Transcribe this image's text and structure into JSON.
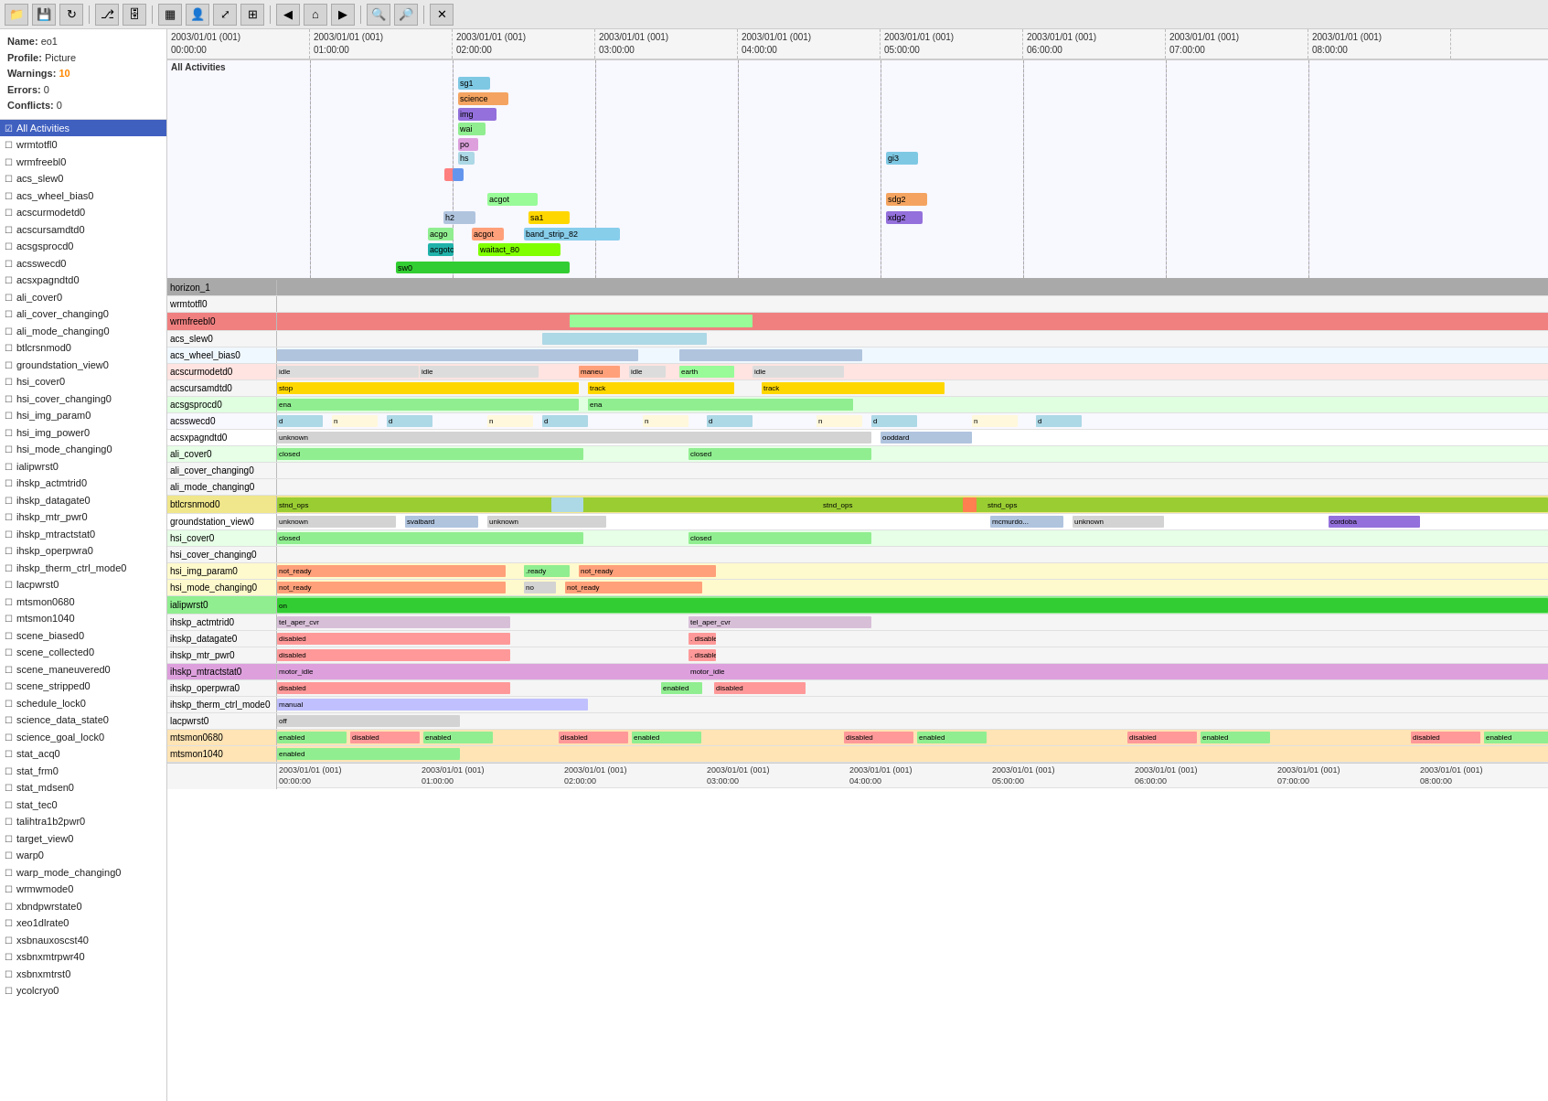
{
  "toolbar": {
    "buttons": [
      {
        "name": "open-folder-btn",
        "icon": "📁",
        "label": "Open Folder"
      },
      {
        "name": "save-btn",
        "icon": "💾",
        "label": "Save"
      },
      {
        "name": "refresh-btn",
        "icon": "🔄",
        "label": "Refresh"
      },
      {
        "name": "branch-btn",
        "icon": "⎇",
        "label": "Branch"
      },
      {
        "name": "db-btn",
        "icon": "🗄",
        "label": "Database"
      },
      {
        "name": "report-btn",
        "icon": "📊",
        "label": "Report"
      },
      {
        "name": "person-btn",
        "icon": "👤",
        "label": "Person"
      },
      {
        "name": "resize-btn",
        "icon": "⤢",
        "label": "Resize"
      },
      {
        "name": "expand-btn",
        "icon": "⊞",
        "label": "Expand"
      },
      {
        "name": "back-btn",
        "icon": "◀",
        "label": "Back"
      },
      {
        "name": "home-btn",
        "icon": "🏠",
        "label": "Home"
      },
      {
        "name": "forward-btn",
        "icon": "▶",
        "label": "Forward"
      },
      {
        "name": "zoom-in-btn",
        "icon": "🔍+",
        "label": "Zoom In"
      },
      {
        "name": "zoom-out-btn",
        "icon": "🔍-",
        "label": "Zoom Out"
      },
      {
        "name": "close-btn",
        "icon": "✕",
        "label": "Close"
      }
    ]
  },
  "info": {
    "name_label": "Name:",
    "name_value": "eo1",
    "profile_label": "Profile:",
    "profile_value": "Picture",
    "warnings_label": "Warnings:",
    "warnings_value": "10",
    "errors_label": "Errors:",
    "errors_value": "0",
    "conflicts_label": "Conflicts:",
    "conflicts_value": "0"
  },
  "activities": [
    {
      "id": "all",
      "label": "All Activities",
      "selected": true
    },
    {
      "id": "wrmtotfl0",
      "label": "wrmtotfl0"
    },
    {
      "id": "wrmfreebl0",
      "label": "wrmfreebl0"
    },
    {
      "id": "acs_slew0",
      "label": "acs_slew0"
    },
    {
      "id": "acs_wheel_bias0",
      "label": "acs_wheel_bias0"
    },
    {
      "id": "acscurmodetd0",
      "label": "acscurmodetd0"
    },
    {
      "id": "acscursamdtd0",
      "label": "acscursamdtd0"
    },
    {
      "id": "acsgsprocd0",
      "label": "acsgsprocd0"
    },
    {
      "id": "acsswecd0",
      "label": "acsswecd0"
    },
    {
      "id": "acsxpagndtd0",
      "label": "acsxpagndtd0"
    },
    {
      "id": "ali_cover0",
      "label": "ali_cover0"
    },
    {
      "id": "ali_cover_changing0",
      "label": "ali_cover_changing0"
    },
    {
      "id": "ali_mode_changing0",
      "label": "ali_mode_changing0"
    },
    {
      "id": "btlcrsnmod0",
      "label": "btlcrsnmod0"
    },
    {
      "id": "groundstation_view0",
      "label": "groundstation_view0"
    },
    {
      "id": "hsi_cover0",
      "label": "hsi_cover0"
    },
    {
      "id": "hsi_cover_changing0",
      "label": "hsi_cover_changing0"
    },
    {
      "id": "hsi_img_param0",
      "label": "hsi_img_param0"
    },
    {
      "id": "hsi_img_power0",
      "label": "hsi_img_power0"
    },
    {
      "id": "hsi_mode_changing0",
      "label": "hsi_mode_changing0"
    },
    {
      "id": "ialipwrst0",
      "label": "ialipwrst0"
    },
    {
      "id": "ihskp_actmtrid0",
      "label": "ihskp_actmtrid0"
    },
    {
      "id": "ihskp_datagate0",
      "label": "ihskp_datagate0"
    },
    {
      "id": "ihskp_mtr_pwr0",
      "label": "ihskp_mtr_pwr0"
    },
    {
      "id": "ihskp_mtractstat0",
      "label": "ihskp_mtractstat0"
    },
    {
      "id": "ihskp_operpwra0",
      "label": "ihskp_operpwra0"
    },
    {
      "id": "ihskp_therm_ctrl_mode0",
      "label": "ihskp_therm_ctrl_mode0"
    },
    {
      "id": "lacpwrst0",
      "label": "lacpwrst0"
    },
    {
      "id": "mtsmon0680",
      "label": "mtsmon0680"
    },
    {
      "id": "mtsmon1040",
      "label": "mtsmon1040"
    },
    {
      "id": "scene_biased0",
      "label": "scene_biased0"
    },
    {
      "id": "scene_collected0",
      "label": "scene_collected0"
    },
    {
      "id": "scene_maneuvered0",
      "label": "scene_maneuvered0"
    },
    {
      "id": "scene_stripped0",
      "label": "scene_stripped0"
    },
    {
      "id": "schedule_lock0",
      "label": "schedule_lock0"
    },
    {
      "id": "science_data_state0",
      "label": "science_data_state0"
    },
    {
      "id": "science_goal_lock0",
      "label": "science_goal_lock0"
    },
    {
      "id": "stat_acq0",
      "label": "stat_acq0"
    },
    {
      "id": "stat_frm0",
      "label": "stat_frm0"
    },
    {
      "id": "stat_mdsen0",
      "label": "stat_mdsen0"
    },
    {
      "id": "stat_tec0",
      "label": "stat_tec0"
    },
    {
      "id": "talihtra1b2pwr0",
      "label": "talihtra1b2pwr0"
    },
    {
      "id": "target_view0",
      "label": "target_view0"
    },
    {
      "id": "warp0",
      "label": "warp0"
    },
    {
      "id": "warp_mode_changing0",
      "label": "warp_mode_changing0"
    },
    {
      "id": "wrmwmode0",
      "label": "wrmwmode0"
    },
    {
      "id": "xbndpwrstate0",
      "label": "xbndpwrstate0"
    },
    {
      "id": "xeo1dlrate0",
      "label": "xeo1dlrate0"
    },
    {
      "id": "xsbnauxoscst40",
      "label": "xsbnauxoscst40"
    },
    {
      "id": "xsbnxmtrpwr40",
      "label": "xsbnxmtrpwr40"
    },
    {
      "id": "xsbnxmtrst0",
      "label": "xsbnxmtrst0"
    },
    {
      "id": "ycolcryo0",
      "label": "ycolcryo0"
    }
  ],
  "timeline": {
    "time_labels": [
      "2003/01/01 (001)\n00:00:00",
      "2003/01/01 (001)\n01:00:00",
      "2003/01/01 (001)\n02:00:00",
      "2003/01/01 (001)\n03:00:00",
      "2003/01/01 (001)\n04:00:00",
      "2003/01/01 (001)\n05:00:00",
      "2003/01/01 (001)\n06:00:00",
      "2003/01/01 (001)\n07:00:00",
      "2003/01/01 (001)\n08:00:00"
    ],
    "all_activities_label": "All Activities"
  },
  "colors": {
    "warning": "#ff8800",
    "selected_bg": "#4060c0",
    "selected_text": "#ffffff"
  }
}
